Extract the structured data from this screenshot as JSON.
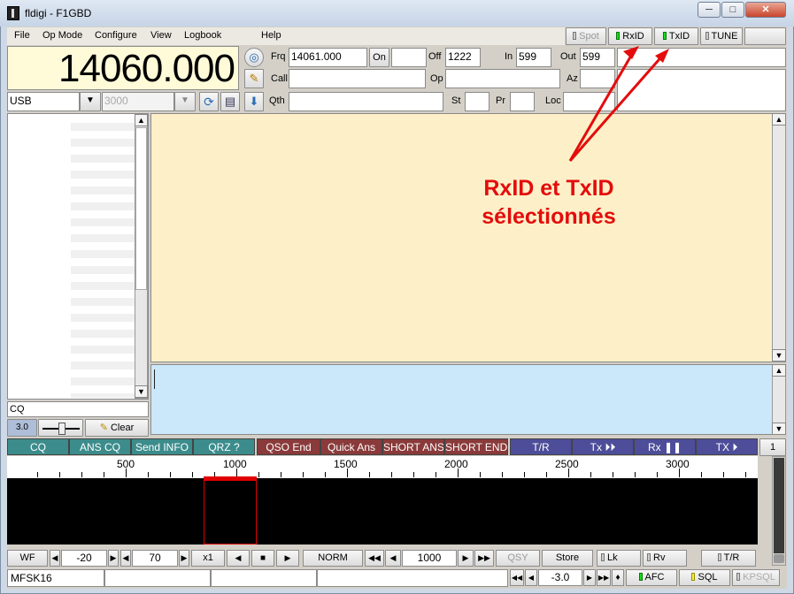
{
  "window": {
    "title": "fldigi - F1GBD",
    "minimize": "─",
    "maximize": "□",
    "close": "✕"
  },
  "menu": [
    "File",
    "Op Mode",
    "Configure",
    "View",
    "Logbook",
    "Help"
  ],
  "menu_mnemonic": [
    "F",
    "M",
    "C",
    "V",
    "L",
    "H"
  ],
  "topbuttons": {
    "spot": "Spot",
    "rxid": "RxID",
    "txid": "TxID",
    "tune": "TUNE"
  },
  "frequency": {
    "display": "14060.000",
    "mode": "USB",
    "bandwidth": "3000"
  },
  "log": {
    "frq_label": "Frq",
    "frq": "14061.000",
    "on_label": "On",
    "on": "",
    "off_label": "Off",
    "off": "1222",
    "in_label": "In",
    "in": "599",
    "out_label": "Out",
    "out": "599",
    "call_label": "Call",
    "call": "",
    "op_label": "Op",
    "op": "",
    "az_label": "Az",
    "az": "",
    "qth_label": "Qth",
    "qth": "",
    "st_label": "St",
    "st": "",
    "pr_label": "Pr",
    "pr": "",
    "loc_label": "Loc",
    "loc": ""
  },
  "left": {
    "cq": "CQ",
    "squelch_value": "3.0",
    "clear": "Clear"
  },
  "macros": [
    {
      "label": "CQ",
      "color": "teal"
    },
    {
      "label": "ANS CQ",
      "color": "teal"
    },
    {
      "label": "Send INFO",
      "color": "teal"
    },
    {
      "label": "QRZ ?",
      "color": "teal"
    },
    {
      "label": "QSO End",
      "color": "maroon"
    },
    {
      "label": "Quick Ans",
      "color": "maroon"
    },
    {
      "label": "SHORT ANS",
      "color": "maroon"
    },
    {
      "label": "SHORT END",
      "color": "maroon"
    },
    {
      "label": "T/R",
      "color": "navy"
    },
    {
      "label": "Tx ⏵⏵",
      "color": "navy"
    },
    {
      "label": "Rx ❚❚",
      "color": "navy"
    },
    {
      "label": "TX ⏵",
      "color": "navy"
    }
  ],
  "macro_set": "1",
  "scale": [
    "500",
    "1000",
    "1500",
    "2000",
    "2500",
    "3000"
  ],
  "wf_controls": {
    "wf": "WF",
    "ref": "-20",
    "range": "70",
    "zoom": "x1",
    "norm": "NORM",
    "carrier": "1000",
    "qsy": "QSY",
    "store": "Store",
    "lk": "Lk",
    "rv": "Rv",
    "tr": "T/R"
  },
  "status": {
    "mode": "MFSK16",
    "afc_value": "-3.0",
    "afc": "AFC",
    "sql": "SQL",
    "kpsql": "KPSQL"
  },
  "annotation": {
    "line1": "RxID et TxID",
    "line2": "sélectionnés",
    "color": "#e40c0c"
  }
}
